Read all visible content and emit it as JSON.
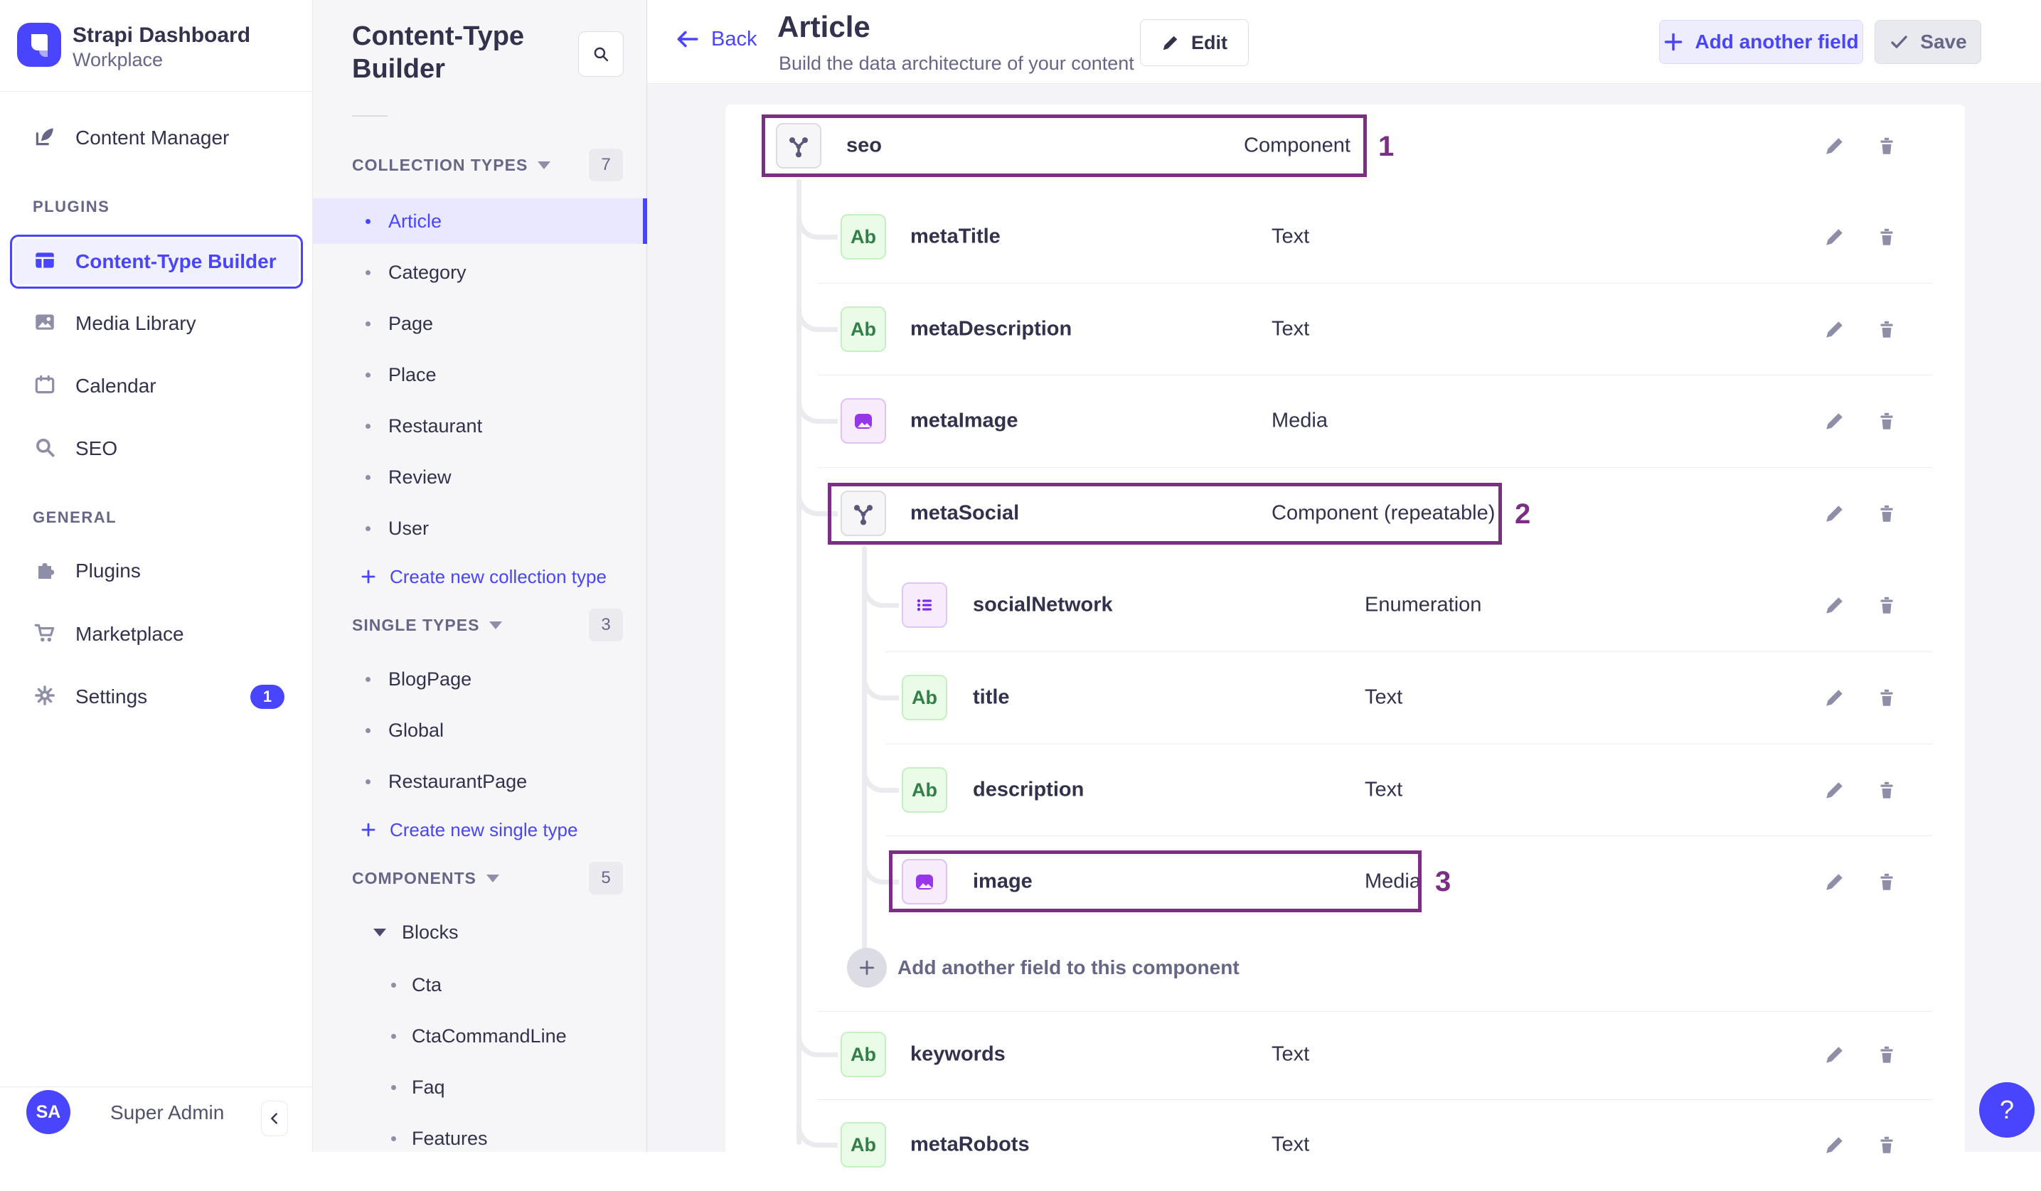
{
  "colors": {
    "accent": "#4945ff",
    "selected_bg": "#e9e8ff",
    "annotation": "#7b2e83",
    "text_dark": "#32324d",
    "text_gray": "#666687",
    "green_icon": "#328048",
    "purple_icon": "#9736e8"
  },
  "brand": {
    "app_name": "Strapi Dashboard",
    "workspace": "Workplace"
  },
  "main_nav": {
    "content_manager": "Content Manager",
    "plugins_section": "PLUGINS",
    "ctb": "Content-Type Builder",
    "media_library": "Media Library",
    "calendar": "Calendar",
    "seo": "SEO",
    "general_section": "GENERAL",
    "plugins": "Plugins",
    "marketplace": "Marketplace",
    "settings": "Settings",
    "settings_badge": "1",
    "user_initials": "SA",
    "user_name": "Super Admin",
    "collapse": "‹"
  },
  "sub_nav": {
    "title": "Content-Type Builder",
    "collection_types": {
      "label": "COLLECTION TYPES",
      "count": "7",
      "items": [
        "Article",
        "Category",
        "Page",
        "Place",
        "Restaurant",
        "Review",
        "User"
      ],
      "create": "Create new collection type"
    },
    "single_types": {
      "label": "SINGLE TYPES",
      "count": "3",
      "items": [
        "BlogPage",
        "Global",
        "RestaurantPage"
      ],
      "create": "Create new single type"
    },
    "components": {
      "label": "COMPONENTS",
      "count": "5",
      "group": "Blocks",
      "items": [
        "Cta",
        "CtaCommandLine",
        "Faq",
        "Features"
      ]
    }
  },
  "header": {
    "back": "Back",
    "title": "Article",
    "subtitle": "Build the data architecture of your content",
    "edit": "Edit",
    "add_field": "Add another field",
    "save": "Save"
  },
  "field_icon_text_label": "Ab",
  "fields": [
    {
      "name": "seo",
      "type": "Component"
    },
    {
      "name": "metaTitle",
      "type": "Text"
    },
    {
      "name": "metaDescription",
      "type": "Text"
    },
    {
      "name": "metaImage",
      "type": "Media"
    },
    {
      "name": "metaSocial",
      "type": "Component (repeatable)"
    },
    {
      "name": "socialNetwork",
      "type": "Enumeration"
    },
    {
      "name": "title",
      "type": "Text"
    },
    {
      "name": "description",
      "type": "Text"
    },
    {
      "name": "image",
      "type": "Media"
    },
    {
      "name": "keywords",
      "type": "Text"
    },
    {
      "name": "metaRobots",
      "type": "Text"
    }
  ],
  "add_field_row_label": "Add another field to this component",
  "annotations": [
    "1",
    "2",
    "3"
  ],
  "help_label": "?"
}
